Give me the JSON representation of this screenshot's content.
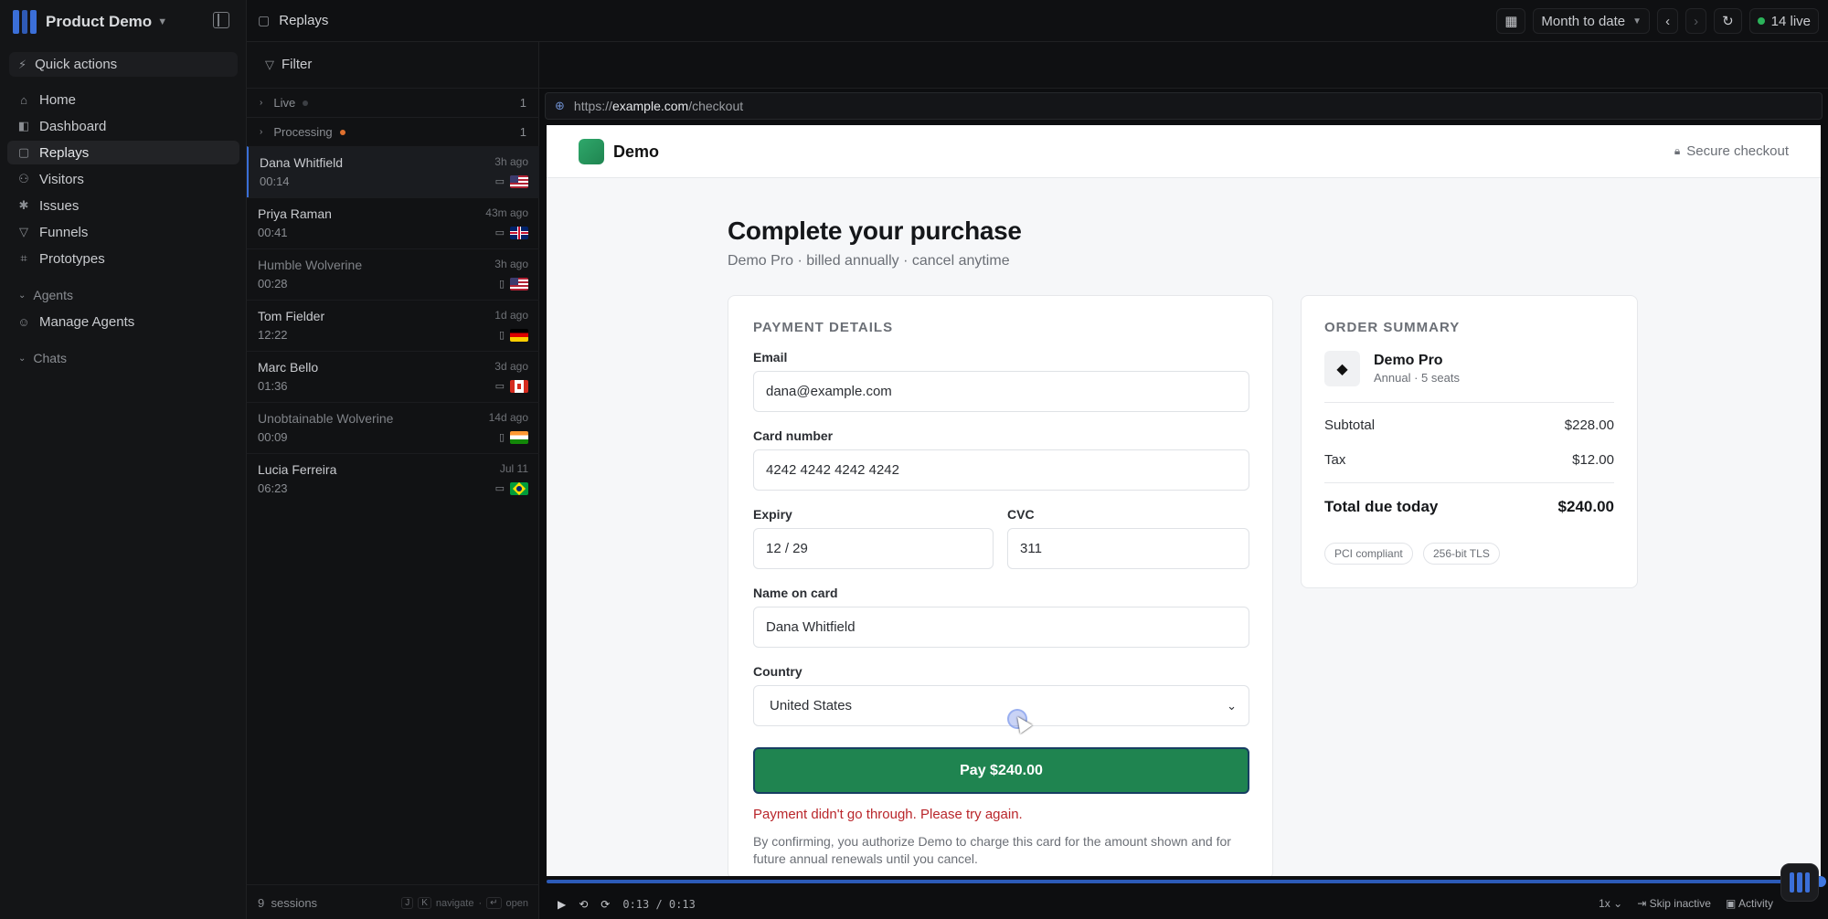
{
  "app": {
    "workspace": "Product Demo"
  },
  "sidebar": {
    "quick_actions": "Quick actions",
    "items": [
      {
        "label": "Home",
        "icon": "home-icon"
      },
      {
        "label": "Dashboard",
        "icon": "dashboard-icon"
      },
      {
        "label": "Replays",
        "icon": "replay-icon",
        "active": true
      },
      {
        "label": "Visitors",
        "icon": "users-icon"
      },
      {
        "label": "Issues",
        "icon": "bug-icon"
      },
      {
        "label": "Funnels",
        "icon": "funnel-icon"
      },
      {
        "label": "Prototypes",
        "icon": "prototype-icon"
      }
    ],
    "agents_section": "Agents",
    "manage_agents": "Manage Agents",
    "chats_section": "Chats"
  },
  "topbar": {
    "title": "Replays",
    "date_range": "Month to date",
    "live_count": "14 live"
  },
  "list": {
    "filter": "Filter",
    "groups": [
      {
        "label": "Live",
        "count": "1"
      },
      {
        "label": "Processing",
        "count": "1"
      }
    ],
    "sessions": [
      {
        "name": "Dana Whitfield",
        "ago": "3h ago",
        "duration": "00:14",
        "device": "desktop",
        "country": "US"
      },
      {
        "name": "Priya Raman",
        "ago": "43m ago",
        "duration": "00:41",
        "device": "desktop",
        "country": "GB"
      },
      {
        "name": "Humble Wolverine",
        "ago": "3h ago",
        "duration": "00:28",
        "device": "mobile",
        "country": "US"
      },
      {
        "name": "Tom Fielder",
        "ago": "1d ago",
        "duration": "12:22",
        "device": "mobile",
        "country": "DE"
      },
      {
        "name": "Marc Bello",
        "ago": "3d ago",
        "duration": "01:36",
        "device": "desktop",
        "country": "CA"
      },
      {
        "name": "Unobtainable Wolverine",
        "ago": "14d ago",
        "duration": "00:09",
        "device": "mobile",
        "country": "IN"
      },
      {
        "name": "Lucia Ferreira",
        "ago": "Jul 11",
        "duration": "06:23",
        "device": "desktop",
        "country": "BR"
      }
    ],
    "footer_count": "9",
    "footer_label": "sessions",
    "hint_keys": [
      "J",
      "K"
    ],
    "hint_navigate": "navigate",
    "hint_enter": "↵",
    "hint_open": "open"
  },
  "player": {
    "url_prefix": "https://",
    "url_host": "example.com",
    "url_path": "/checkout",
    "time": "0:13 / 0:13",
    "speed": "1x",
    "skip_inactive": "Skip inactive",
    "activity": "Activity"
  },
  "checkout": {
    "brand": "Demo",
    "secure": "Secure checkout",
    "title": "Complete your purchase",
    "subtitle": "Demo Pro · billed annually · cancel anytime",
    "payment": {
      "heading": "PAYMENT DETAILS",
      "email_label": "Email",
      "email_value": "dana@example.com",
      "card_label": "Card number",
      "card_value": "4242 4242 4242 4242",
      "expiry_label": "Expiry",
      "expiry_value": "12 / 29",
      "cvc_label": "CVC",
      "cvc_value": "311",
      "name_label": "Name on card",
      "name_value": "Dana Whitfield",
      "country_label": "Country",
      "country_value": "United States",
      "pay_button": "Pay $240.00",
      "error": "Payment didn't go through. Please try again.",
      "legal": "By confirming, you authorize Demo to charge this card for the amount shown and for future annual renewals until you cancel."
    },
    "summary": {
      "heading": "ORDER SUMMARY",
      "product": "Demo Pro",
      "product_meta": "Annual · 5 seats",
      "subtotal_label": "Subtotal",
      "subtotal": "$228.00",
      "tax_label": "Tax",
      "tax": "$12.00",
      "total_label": "Total due today",
      "total": "$240.00",
      "badges": [
        "PCI compliant",
        "256-bit TLS"
      ]
    }
  },
  "colors": {
    "accent": "#3b6fd8",
    "pay_button": "#1f8450",
    "error": "#b9262b",
    "live_dot": "#2bb35a",
    "processing_dot": "#e0702e"
  }
}
